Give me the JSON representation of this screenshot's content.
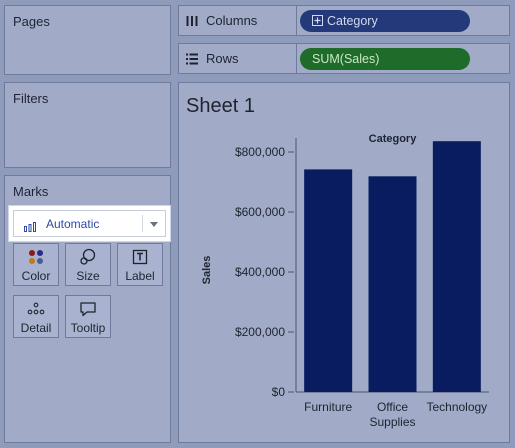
{
  "pages": {
    "title": "Pages"
  },
  "filters": {
    "title": "Filters"
  },
  "marks": {
    "title": "Marks",
    "mark_type": "Automatic",
    "buttons": [
      {
        "label": "Color",
        "icon": "color-icon"
      },
      {
        "label": "Size",
        "icon": "size-icon"
      },
      {
        "label": "Label",
        "icon": "label-icon"
      },
      {
        "label": "Detail",
        "icon": "detail-icon"
      },
      {
        "label": "Tooltip",
        "icon": "tooltip-icon"
      }
    ]
  },
  "shelves": {
    "columns": {
      "label": "Columns",
      "pill": "Category",
      "pill_color": "#24397a"
    },
    "rows": {
      "label": "Rows",
      "pill": "SUM(Sales)",
      "pill_color": "#1e6b2a"
    }
  },
  "sheet": {
    "title": "Sheet 1"
  },
  "colors": {
    "bar": "#081c5f",
    "background": "#8f9bbb"
  },
  "chart_data": {
    "type": "bar",
    "title": "Category",
    "xlabel": "",
    "ylabel": "Sales",
    "categories": [
      {
        "lines": [
          "Furniture"
        ]
      },
      {
        "lines": [
          "Office",
          "Supplies"
        ]
      },
      {
        "lines": [
          "Technology"
        ]
      }
    ],
    "category_names": [
      "Furniture",
      "Office Supplies",
      "Technology"
    ],
    "values": [
      742000,
      719000,
      836000
    ],
    "yticks": [
      0,
      200000,
      400000,
      600000,
      800000
    ],
    "ytick_labels": [
      "$0",
      "$200,000",
      "$400,000",
      "$600,000",
      "$800,000"
    ],
    "ylim": [
      0,
      800000
    ],
    "grid": false
  }
}
